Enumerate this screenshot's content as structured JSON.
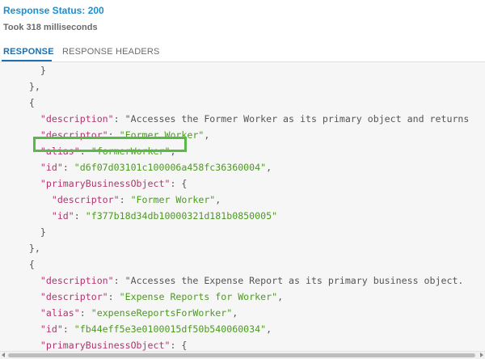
{
  "header": {
    "status": "Response Status: 200",
    "took": "Took 318 milliseconds"
  },
  "tabs": [
    {
      "label": "RESPONSE",
      "active": true
    },
    {
      "label": "RESPONSE HEADERS",
      "active": false
    }
  ],
  "json_lines": [
    "      }",
    "    },",
    "    {",
    "      \"description\": \"Accesses the Former Worker as its primary object and returns",
    "      \"descriptor\": \"Former Worker\",",
    "      \"alias\": \"formerWorker\",",
    "      \"id\": \"d6f07d03101c100006a458fc36360004\",",
    "      \"primaryBusinessObject\": {",
    "        \"descriptor\": \"Former Worker\",",
    "        \"id\": \"f377b18d34db10000321d181b0850005\"",
    "      }",
    "    },",
    "    {",
    "      \"description\": \"Accesses the Expense Report as its primary business object.",
    "      \"descriptor\": \"Expense Reports for Worker\",",
    "      \"alias\": \"expenseReportsForWorker\",",
    "      \"id\": \"fb44eff5e3e0100015df50b540060034\",",
    "      \"primaryBusinessObject\": {"
  ],
  "highlighted_line": "      \"alias\": \"formerWorker\",",
  "colors": {
    "status": "#1a8fd0",
    "key": "#b0356f",
    "string": "#4b9a1f",
    "highlight_border": "#59b946"
  }
}
